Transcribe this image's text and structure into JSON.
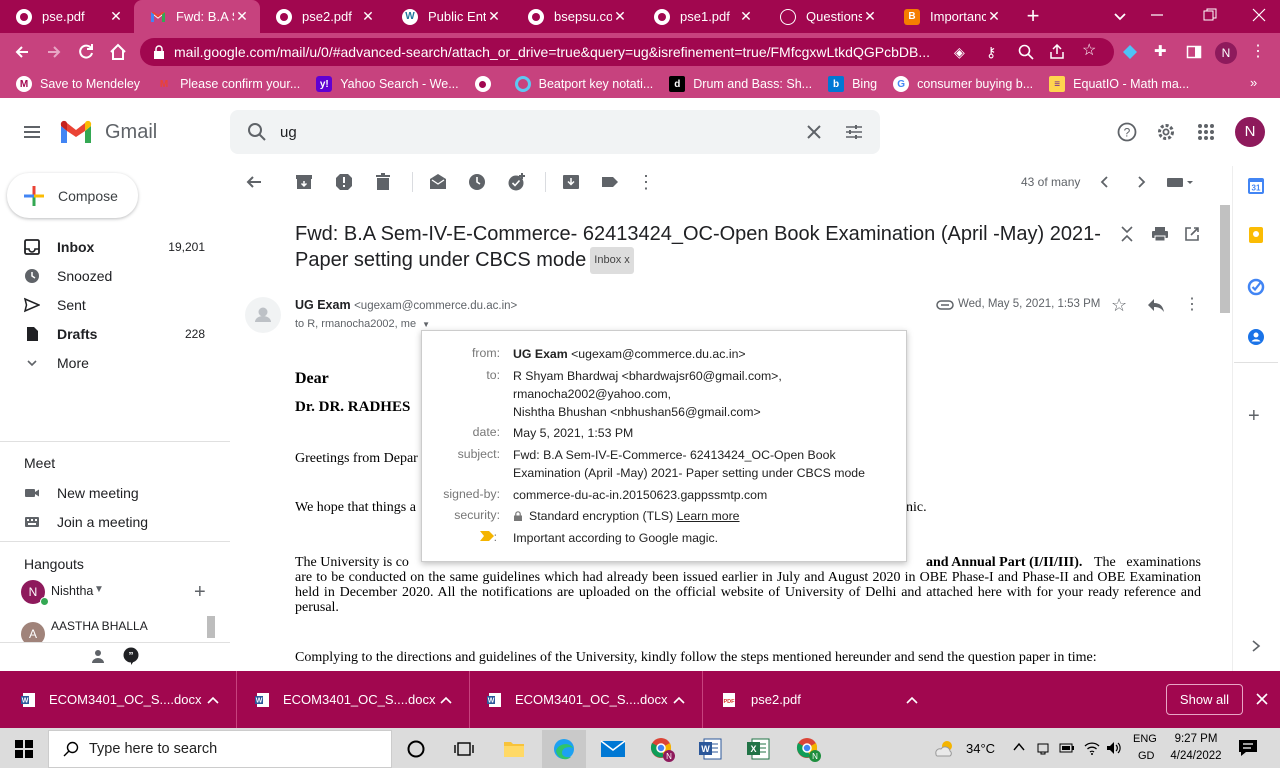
{
  "browser": {
    "tabs": [
      {
        "title": "pse.pdf",
        "icon": "chrome-icon"
      },
      {
        "title": "Fwd: B.A Se",
        "icon": "gmail-icon",
        "active": true
      },
      {
        "title": "pse2.pdf",
        "icon": "chrome-icon"
      },
      {
        "title": "Public Ente",
        "icon": "wordpress-icon"
      },
      {
        "title": "bsepsu.com",
        "icon": "chrome-icon"
      },
      {
        "title": "pse1.pdf",
        "icon": "chrome-icon"
      },
      {
        "title": "Questions_",
        "icon": "globe-icon"
      },
      {
        "title": "Importance",
        "icon": "blogger-icon"
      }
    ],
    "url": "mail.google.com/mail/u/0/#advanced-search/attach_or_drive=true&query=ug&isrefinement=true/FMfcgxwLtkdQGPcbDB...",
    "profile_initial": "N",
    "bookmarks": [
      "Save to Mendeley",
      "Please confirm your...",
      "Yahoo Search - We...",
      "",
      "Beatport key notati...",
      "Drum and Bass: Sh...",
      "Bing",
      "consumer buying b...",
      "EquatIO - Math ma..."
    ]
  },
  "gmail": {
    "logo_text": "Gmail",
    "search_value": "ug",
    "avatar_initial": "N",
    "compose_label": "Compose",
    "nav": [
      {
        "label": "Inbox",
        "count": "19,201",
        "bold": true
      },
      {
        "label": "Snoozed",
        "count": ""
      },
      {
        "label": "Sent",
        "count": ""
      },
      {
        "label": "Drafts",
        "count": "228",
        "bold": true
      },
      {
        "label": "More",
        "count": ""
      }
    ],
    "meet_title": "Meet",
    "meet_items": [
      "New meeting",
      "Join a meeting"
    ],
    "hangouts_title": "Hangouts",
    "hangouts_user": "Nishtha",
    "hangouts_contact": "AASTHA BHALLA",
    "pager": "43 of many"
  },
  "email": {
    "subject_line1": "Fwd: B.A Sem-IV-E-Commerce- 62413424_OC-Open Book Examination (April -May) 2021-",
    "subject_line2": "Paper setting under CBCS mode",
    "label_chip": "Inbox",
    "sender_name": "UG Exam",
    "sender_email": "<ugexam@commerce.du.ac.in>",
    "to_line": "to R, rmanocha2002, me",
    "date": "Wed, May 5, 2021, 1:53 PM",
    "body": {
      "salutation": "Dear",
      "name": "Dr. DR. RADHES",
      "greeting": "Greetings from Depar",
      "hope_start": "We hope that things a",
      "hope_end": "nic.",
      "para_start": "The University is co",
      "para_mid": "and Annual Part (I/II/III).",
      "para_rest": "The examinations are to be conducted on the same guidelines which had already been issued earlier in July and August 2020 in OBE Phase-I and Phase-II and OBE Examination held in December 2020. All the notifications are uploaded on the official website of University of Delhi and attached here with for your ready reference and perusal.",
      "complying": "Complying to the directions and guidelines of the University, kindly follow the steps mentioned hereunder and send the question paper in time:"
    },
    "details": {
      "from_label": "from:",
      "from_name": "UG Exam",
      "from_email": "<ugexam@commerce.du.ac.in>",
      "to_label": "to:",
      "to_lines": [
        "R Shyam Bhardwaj <bhardwajsr60@gmail.com>,",
        "rmanocha2002@yahoo.com,",
        "Nishtha Bhushan <nbhushan56@gmail.com>"
      ],
      "date_label": "date:",
      "date_value": "May 5, 2021, 1:53 PM",
      "subject_label": "subject:",
      "subject_lines": [
        "Fwd: B.A Sem-IV-E-Commerce- 62413424_OC-Open Book",
        "Examination (April -May) 2021- Paper setting under CBCS mode"
      ],
      "signed_label": "signed-by:",
      "signed_value": "commerce-du-ac-in.20150623.gappssmtp.com",
      "security_label": "security:",
      "security_value": "Standard encryption (TLS)",
      "learn_more": "Learn more",
      "importance_value": "Important according to Google magic."
    }
  },
  "downloads": {
    "items": [
      "ECOM3401_OC_S....docx",
      "ECOM3401_OC_S....docx",
      "ECOM3401_OC_S....docx",
      "pse2.pdf"
    ],
    "show_all": "Show all"
  },
  "taskbar": {
    "search_placeholder": "Type here to search",
    "temperature": "34°C",
    "lang1": "ENG",
    "lang2": "GD",
    "time": "9:27 PM",
    "date": "4/24/2022"
  },
  "colors": {
    "chrome_dark": "#a1074f",
    "chrome_mid": "#c7427e",
    "gmail_red": "#ea4335",
    "avatar": "#8e1a5c"
  }
}
